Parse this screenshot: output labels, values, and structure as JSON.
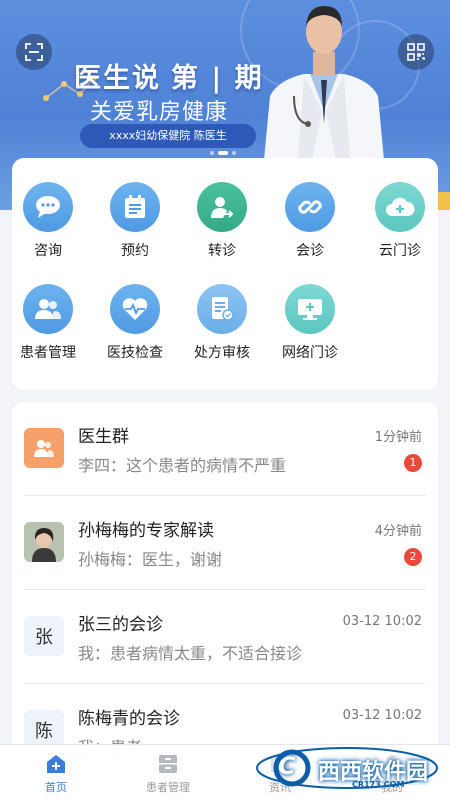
{
  "banner": {
    "title": "医生说",
    "issue": "第 | 期",
    "subtitle": "关爱乳房健康",
    "ribbon": "xxxx妇幼保健院   陈医生",
    "pages": 3,
    "active_page": 2
  },
  "menu": [
    {
      "label": "咨询",
      "icon": "chat-bubble-icon",
      "color": "#5aa7ea"
    },
    {
      "label": "预约",
      "icon": "calendar-icon",
      "color": "#5aa7ea"
    },
    {
      "label": "转诊",
      "icon": "user-transfer-icon",
      "color": "#3db592"
    },
    {
      "label": "会诊",
      "icon": "link-icon",
      "color": "#5aa7ea"
    },
    {
      "label": "云门诊",
      "icon": "cloud-plus-icon",
      "color": "#6fd0ca"
    },
    {
      "label": "患者管理",
      "icon": "patients-icon",
      "color": "#5aa7ea"
    },
    {
      "label": "医技检查",
      "icon": "heart-pulse-icon",
      "color": "#5aa7ea"
    },
    {
      "label": "处方审核",
      "icon": "prescription-icon",
      "color": "#8ec4f2"
    },
    {
      "label": "网络门诊",
      "icon": "monitor-plus-icon",
      "color": "#6fd0ca"
    }
  ],
  "messages": [
    {
      "name": "医生群",
      "preview": "李四：这个患者的病情不严重",
      "time": "1分钟前",
      "badge": "1",
      "avatar": "group"
    },
    {
      "name": "孙梅梅的专家解读",
      "preview": "孙梅梅：医生，谢谢",
      "time": "4分钟前",
      "badge": "2",
      "avatar": "photo"
    },
    {
      "name": "张三的会诊",
      "preview": "我：患者病情太重，不适合接诊",
      "time": "03-12 10:02",
      "badge": "",
      "avatar": "张"
    },
    {
      "name": "陈梅青的会诊",
      "preview": "我：患者",
      "time": "03-12 10:02",
      "badge": "",
      "avatar": "陈"
    }
  ],
  "tabs": [
    {
      "label": "首页",
      "icon": "home-plus-icon",
      "active": true
    },
    {
      "label": "患者管理",
      "icon": "cabinet-icon",
      "active": false
    },
    {
      "label": "资讯",
      "icon": "news-icon",
      "active": false
    },
    {
      "label": "我的",
      "icon": "profile-icon",
      "active": false
    }
  ],
  "watermark": {
    "text": "西西软件园",
    "url": "CR173.COM"
  }
}
